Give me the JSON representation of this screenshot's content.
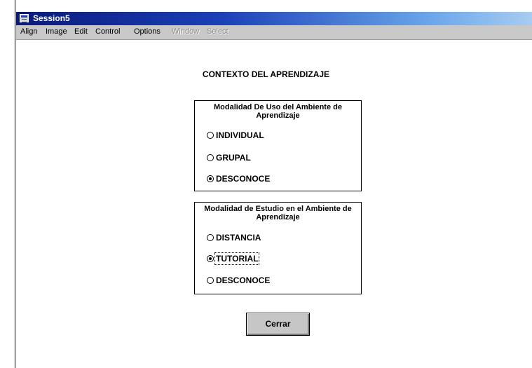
{
  "window": {
    "title": "Session5"
  },
  "menu": {
    "items": [
      {
        "label": "Align",
        "enabled": true
      },
      {
        "label": "Image",
        "enabled": true
      },
      {
        "label": "Edit",
        "enabled": true
      },
      {
        "label": "Control",
        "enabled": true
      },
      {
        "label": "Options",
        "enabled": true
      },
      {
        "label": "Window",
        "enabled": false
      },
      {
        "label": "Select",
        "enabled": false
      }
    ]
  },
  "heading": "CONTEXTO DEL APRENDIZAJE",
  "group1": {
    "title": "Modalidad De Uso del Ambiente de Aprendizaje",
    "options": [
      {
        "label": "INDIVIDUAL",
        "checked": false
      },
      {
        "label": "GRUPAL",
        "checked": false
      },
      {
        "label": "DESCONOCE",
        "checked": true
      }
    ]
  },
  "group2": {
    "title": "Modalidad de Estudio en el Ambiente de Aprendizaje",
    "options": [
      {
        "label": "DISTANCIA",
        "checked": false
      },
      {
        "label": "TUTORIAL",
        "checked": true
      },
      {
        "label": "DESCONOCE",
        "checked": false
      }
    ]
  },
  "close_button": {
    "label": "Cerrar"
  }
}
